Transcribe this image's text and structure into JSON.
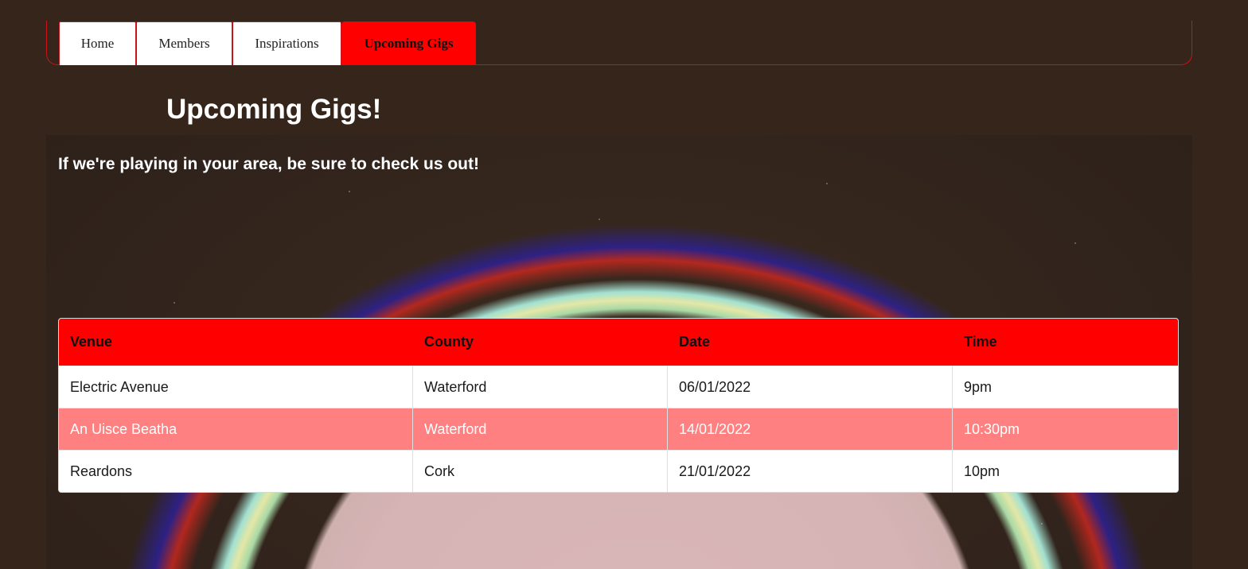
{
  "nav": {
    "tabs": [
      {
        "label": "Home"
      },
      {
        "label": "Members"
      },
      {
        "label": "Inspirations"
      },
      {
        "label": "Upcoming Gigs"
      }
    ],
    "active": "Upcoming Gigs"
  },
  "main": {
    "title": "Upcoming Gigs!",
    "subtitle": "If we're playing in your area, be sure to check us out!"
  },
  "gigs_table": {
    "headers": [
      "Venue",
      "County",
      "Date",
      "Time"
    ],
    "rows": [
      [
        "Electric Avenue",
        "Waterford",
        "06/01/2022",
        "9pm"
      ],
      [
        "An Uisce Beatha",
        "Waterford",
        "14/01/2022",
        "10:30pm"
      ],
      [
        "Reardons",
        "Cork",
        "21/01/2022",
        "10pm"
      ]
    ]
  },
  "colors": {
    "accent": "#ff0000",
    "background": "#35251a",
    "alt_row": "#ff8080"
  }
}
